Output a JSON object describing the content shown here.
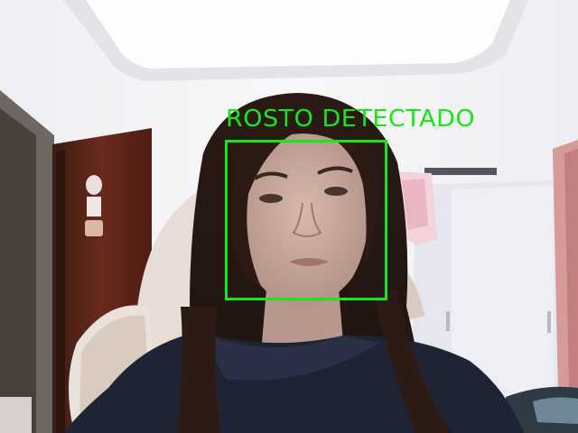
{
  "overlay": {
    "label": "ROSTO DETECTADO",
    "color": "#19e619"
  }
}
